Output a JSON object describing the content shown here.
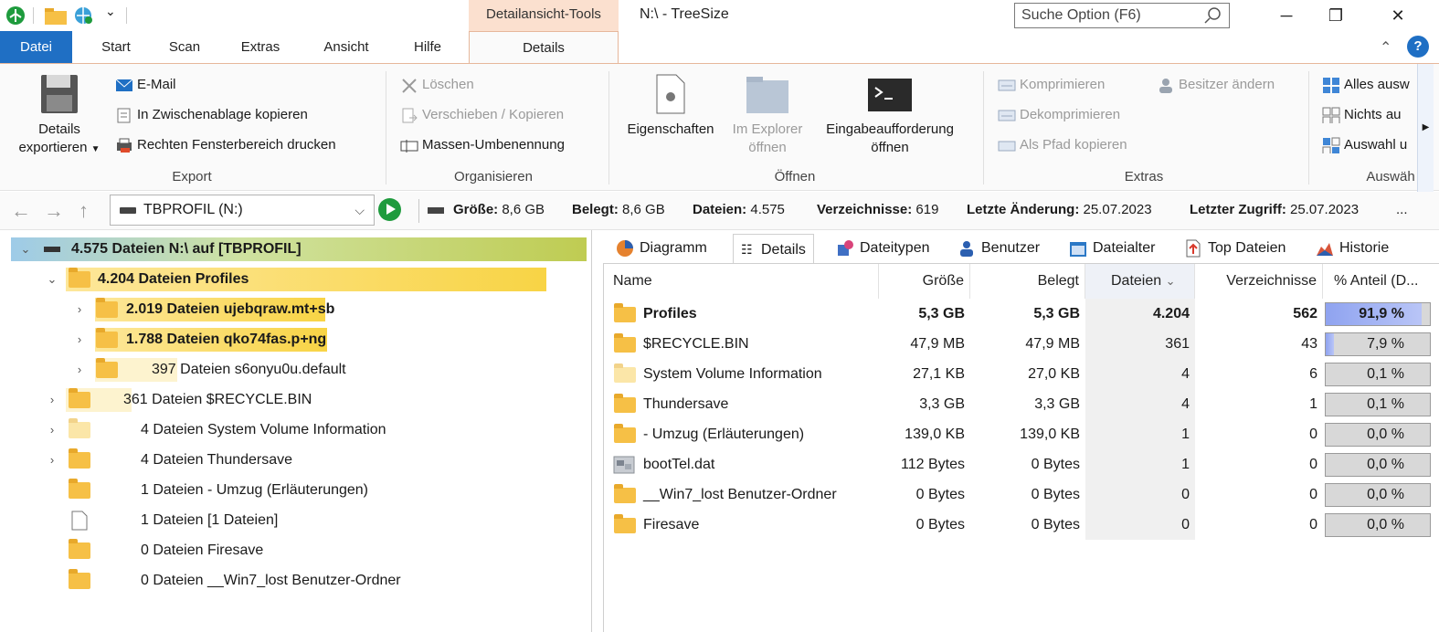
{
  "title_bar": {
    "context_tab_group": "Detailansicht-Tools",
    "window_title": "N:\\ - TreeSize",
    "search_placeholder": "Suche Option (F6)"
  },
  "ribbon_tabs": [
    "Datei",
    "Start",
    "Scan",
    "Extras",
    "Ansicht",
    "Hilfe",
    "Details"
  ],
  "help_label": "?",
  "ribbon": {
    "export": {
      "label": "Export",
      "details_export_line1": "Details",
      "details_export_line2": "exportieren",
      "email": "E-Mail",
      "clipboard": "In Zwischenablage kopieren",
      "print": "Rechten Fensterbereich drucken"
    },
    "organisieren": {
      "label": "Organisieren",
      "delete": "Löschen",
      "move_copy": "Verschieben / Kopieren",
      "mass_rename": "Massen-Umbenennung"
    },
    "oeffnen": {
      "label": "Öffnen",
      "properties": "Eigenschaften",
      "explorer_line1": "Im Explorer",
      "explorer_line2": "öffnen",
      "prompt_line1": "Eingabeaufforderung",
      "prompt_line2": "öffnen"
    },
    "extras": {
      "label": "Extras",
      "compress": "Komprimieren",
      "decompress": "Dekomprimieren",
      "copy_path": "Als Pfad kopieren",
      "change_owner": "Besitzer ändern"
    },
    "auswahl": {
      "label": "Auswäh",
      "select_all": "Alles ausw",
      "select_none": "Nichts au",
      "invert": "Auswahl u"
    }
  },
  "navbar": {
    "drive": "TBPROFIL (N:)",
    "size_label": "Größe:",
    "size_value": "8,6 GB",
    "used_label": "Belegt:",
    "used_value": "8,6 GB",
    "files_label": "Dateien:",
    "files_value": "4.575",
    "dirs_label": "Verzeichnisse:",
    "dirs_value": "619",
    "modified_label": "Letzte Änderung:",
    "modified_value": "25.07.2023",
    "accessed_label": "Letzter Zugriff:",
    "accessed_value": "25.07.2023",
    "more": "..."
  },
  "tree": [
    {
      "text": "4.575 Dateien   N:\\  auf  [TBPROFIL]"
    },
    {
      "text": "4.204 Dateien   Profiles"
    },
    {
      "text": "2.019 Dateien   ujebqraw.mt+sb"
    },
    {
      "text": "1.788 Dateien   qko74fas.p+ng"
    },
    {
      "text": "397 Dateien    s6onyu0u.default"
    },
    {
      "text": "361 Dateien    $RECYCLE.BIN"
    },
    {
      "text": "4 Dateien    System Volume Information"
    },
    {
      "text": "4 Dateien    Thundersave"
    },
    {
      "text": "1 Dateien    - Umzug (Erläuterungen)"
    },
    {
      "text": "1 Dateien    [1 Dateien]"
    },
    {
      "text": "0 Dateien    Firesave"
    },
    {
      "text": "0 Dateien    __Win7_lost Benutzer-Ordner"
    }
  ],
  "view_tabs": [
    "Diagramm",
    "Details",
    "Dateitypen",
    "Benutzer",
    "Dateialter",
    "Top Dateien",
    "Historie"
  ],
  "columns": [
    "Name",
    "Größe",
    "Belegt",
    "Dateien",
    "Verzeichnisse",
    "% Anteil (D..."
  ],
  "sort_indicator": "⌄",
  "rows": [
    {
      "name": "Profiles",
      "size": "5,3 GB",
      "used": "5,3 GB",
      "files": "4.204",
      "dirs": "562",
      "pct": "91,9 %",
      "pct_value": 91.9
    },
    {
      "name": "$RECYCLE.BIN",
      "size": "47,9 MB",
      "used": "47,9 MB",
      "files": "361",
      "dirs": "43",
      "pct": "7,9 %",
      "pct_value": 7.9
    },
    {
      "name": "System Volume Information",
      "size": "27,1 KB",
      "used": "27,0 KB",
      "files": "4",
      "dirs": "6",
      "pct": "0,1 %",
      "pct_value": 0.1
    },
    {
      "name": "Thundersave",
      "size": "3,3 GB",
      "used": "3,3 GB",
      "files": "4",
      "dirs": "1",
      "pct": "0,1 %",
      "pct_value": 0.1
    },
    {
      "name": "- Umzug (Erläuterungen)",
      "size": "139,0 KB",
      "used": "139,0 KB",
      "files": "1",
      "dirs": "0",
      "pct": "0,0 %",
      "pct_value": 0
    },
    {
      "name": "bootTel.dat",
      "size": "112 Bytes",
      "used": "0 Bytes",
      "files": "1",
      "dirs": "0",
      "pct": "0,0 %",
      "pct_value": 0
    },
    {
      "name": "__Win7_lost Benutzer-Ordner",
      "size": "0 Bytes",
      "used": "0 Bytes",
      "files": "0",
      "dirs": "0",
      "pct": "0,0 %",
      "pct_value": 0
    },
    {
      "name": "Firesave",
      "size": "0 Bytes",
      "used": "0 Bytes",
      "files": "0",
      "dirs": "0",
      "pct": "0,0 %",
      "pct_value": 0
    }
  ],
  "colors": {
    "accent": "#1f6fc4",
    "context_tab": "#fbe0cf",
    "pct_fill": "#8fa3f0",
    "folder": "#f6c046"
  }
}
